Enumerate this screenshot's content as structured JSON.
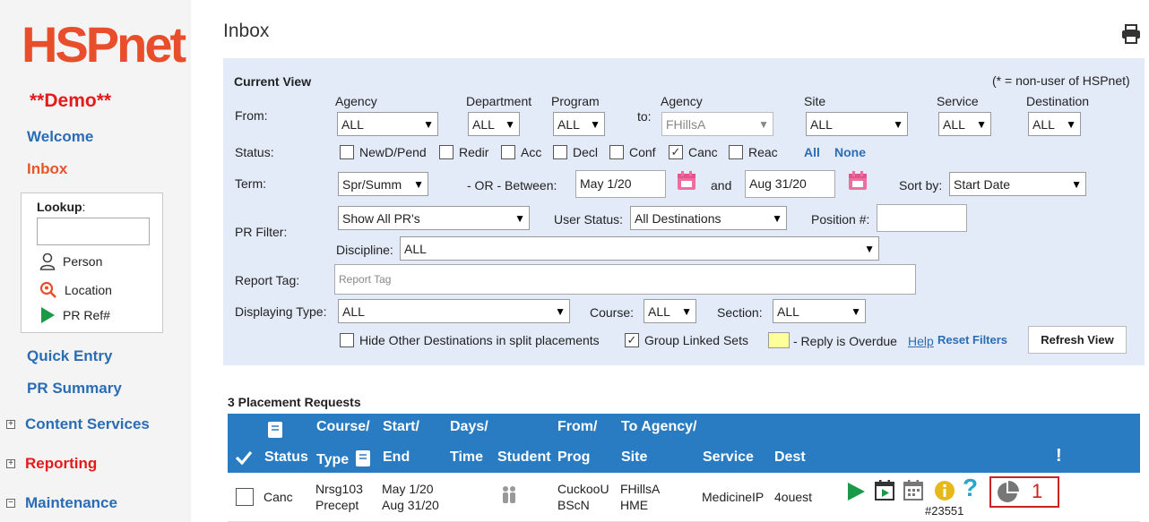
{
  "sidebar": {
    "logo": "HSPnet",
    "demo_label": "**Demo**",
    "welcome": "Welcome",
    "inbox": "Inbox",
    "lookup_label": "Lookup",
    "lookup_colon": ":",
    "lookup_person": "Person",
    "lookup_location": "Location",
    "lookup_prref": "PR Ref#",
    "quick_entry": "Quick Entry",
    "pr_summary": "PR Summary",
    "content_services": "Content Services",
    "reporting": "Reporting",
    "maintenance": "Maintenance"
  },
  "page": {
    "title": "Inbox"
  },
  "filters": {
    "current_view": "Current View",
    "non_user_note": "(* = non-user of HSPnet)",
    "from_label": "From:",
    "to_label": "to:",
    "agency_label": "Agency",
    "department_label": "Department",
    "program_label": "Program",
    "to_agency_label": "Agency",
    "site_label": "Site",
    "service_label": "Service",
    "destination_label": "Destination",
    "from_agency": "ALL",
    "from_department": "ALL",
    "from_program": "ALL",
    "to_agency": "FHillsA",
    "to_site": "ALL",
    "to_service": "ALL",
    "to_destination": "ALL",
    "status_label": "Status:",
    "statuses": [
      {
        "label": "NewD/Pend",
        "checked": false
      },
      {
        "label": "Redir",
        "checked": false
      },
      {
        "label": "Acc",
        "checked": false
      },
      {
        "label": "Decl",
        "checked": false
      },
      {
        "label": "Conf",
        "checked": false
      },
      {
        "label": "Canc",
        "checked": true
      },
      {
        "label": "Reac",
        "checked": false
      }
    ],
    "all_link": "All",
    "none_link": "None",
    "term_label": "Term:",
    "term_value": "Spr/Summ",
    "or_between": "- OR -  Between:",
    "start_date": "May 1/20",
    "and_label": "and",
    "end_date": "Aug 31/20",
    "sort_by_label": "Sort by:",
    "sort_by_value": "Start Date",
    "pr_filter_label": "PR Filter:",
    "pr_filter_value": "Show All PR's",
    "user_status_label": "User Status:",
    "user_status_value": "All Destinations",
    "position_label": "Position #:",
    "position_value": "",
    "discipline_label": "Discipline:",
    "discipline_value": "ALL",
    "report_tag_label": "Report Tag:",
    "report_tag_placeholder": "Report Tag",
    "displaying_type_label": "Displaying Type:",
    "displaying_type_value": "ALL",
    "course_label": "Course:",
    "course_value": "ALL",
    "section_label": "Section:",
    "section_value": "ALL",
    "hide_other_label": "Hide Other Destinations in split placements",
    "hide_other_checked": false,
    "group_linked_label": "Group Linked Sets",
    "group_linked_checked": true,
    "overdue_label": "- Reply is Overdue",
    "overdue_color": "#ffff99",
    "help_link": "Help",
    "reset_filters": "Reset Filters",
    "refresh_view": "Refresh View"
  },
  "results": {
    "count_label": "3 Placement Requests",
    "headers": {
      "status": "Status",
      "course_top": "Course/",
      "course_bottom": "Type",
      "start_top": "Start/",
      "start_bottom": "End",
      "days_top": "Days/",
      "days_bottom": "Time",
      "student": "Student",
      "from_top": "From/",
      "from_bottom": "Prog",
      "to_top": "To Agency/",
      "to_bottom": "Site",
      "service": "Service",
      "dest": "Dest",
      "alert": "!"
    },
    "rows": [
      {
        "status": "Canc",
        "course": "Nrsg103",
        "type": "Precept",
        "start": "May 1/20",
        "end": "Aug 31/20",
        "from": "CuckooU",
        "prog": "BScN",
        "to_agency": "FHillsA",
        "site": "HME",
        "service": "MedicineIP",
        "dest": "4ouest",
        "pr_number": "#23551",
        "badge_count": "1"
      }
    ]
  },
  "colors": {
    "brand": "#e84e2c",
    "link": "#2a6db5",
    "header_bg": "#2a7cc2",
    "filter_bg": "#e4ebf8",
    "highlight": "#cc2222"
  }
}
